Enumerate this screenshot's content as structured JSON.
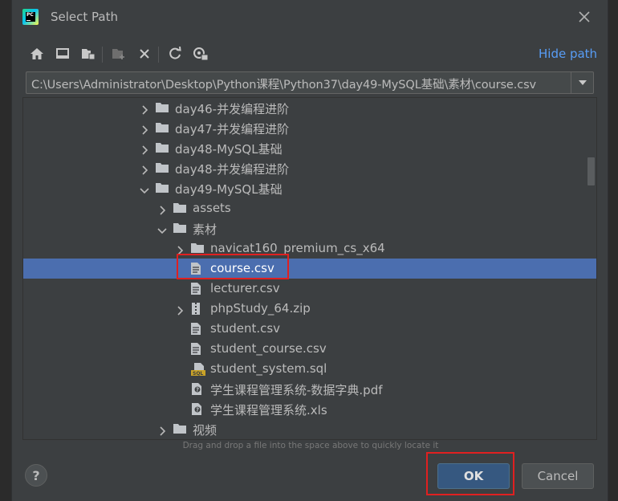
{
  "dialog": {
    "title": "Select Path",
    "hide_path_label": "Hide path",
    "path_value": "C:\\Users\\Administrator\\Desktop\\Python课程\\Python37\\day49-MySQL基础\\素材\\course.csv",
    "hint": "Drag and drop a file into the space above to quickly locate it",
    "help_label": "?",
    "ok_label": "OK",
    "cancel_label": "Cancel"
  },
  "app_icon": {
    "text": "PC",
    "colors": [
      "#21d789",
      "#07c3f2",
      "#fcf84a"
    ]
  },
  "toolbar": {
    "icons": [
      "home-icon",
      "desktop-icon",
      "project-folder-icon",
      "new-folder-icon",
      "delete-icon",
      "refresh-icon",
      "show-hidden-icon"
    ]
  },
  "tree": {
    "rows": [
      {
        "label": "day46-并发编程进阶",
        "type": "folder",
        "expanded": false,
        "level": 0
      },
      {
        "label": "day47-并发编程进阶",
        "type": "folder",
        "expanded": false,
        "level": 0
      },
      {
        "label": "day48-MySQL基础",
        "type": "folder",
        "expanded": false,
        "level": 0
      },
      {
        "label": "day48-并发编程进阶",
        "type": "folder",
        "expanded": false,
        "level": 0
      },
      {
        "label": "day49-MySQL基础",
        "type": "folder",
        "expanded": true,
        "level": 0
      },
      {
        "label": "assets",
        "type": "folder",
        "expanded": false,
        "level": 1
      },
      {
        "label": "素材",
        "type": "folder",
        "expanded": true,
        "level": 1
      },
      {
        "label": "navicat160_premium_cs_x64",
        "type": "folder",
        "expanded": false,
        "level": 2
      },
      {
        "label": "course.csv",
        "type": "text",
        "level": 2,
        "selected": true
      },
      {
        "label": "lecturer.csv",
        "type": "text",
        "level": 2
      },
      {
        "label": "phpStudy_64.zip",
        "type": "archive",
        "expanded": false,
        "level": 2
      },
      {
        "label": "student.csv",
        "type": "text",
        "level": 2
      },
      {
        "label": "student_course.csv",
        "type": "text",
        "level": 2
      },
      {
        "label": "student_system.sql",
        "type": "sql",
        "level": 2
      },
      {
        "label": "学生课程管理系统-数据字典.pdf",
        "type": "unknown",
        "level": 2
      },
      {
        "label": "学生课程管理系统.xls",
        "type": "unknown",
        "level": 2
      },
      {
        "label": "视频",
        "type": "folder",
        "expanded": false,
        "level": 1
      }
    ]
  },
  "colors": {
    "background": "#3c3f41",
    "selection": "#4b6eaf",
    "link": "#589df6",
    "highlight": "#e02020",
    "ok_button": "#365880"
  }
}
